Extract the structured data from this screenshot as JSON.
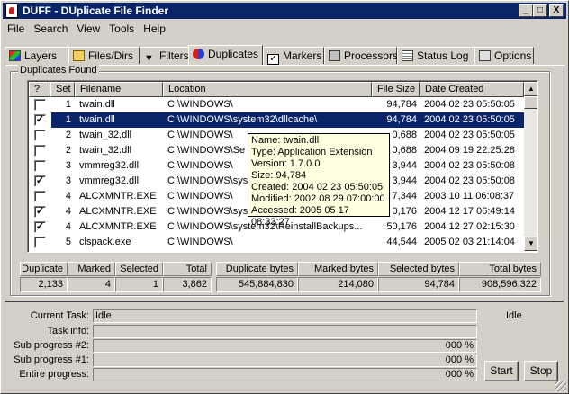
{
  "window": {
    "title": "DUFF - DUplicate File Finder"
  },
  "menu": [
    "File",
    "Search",
    "View",
    "Tools",
    "Help"
  ],
  "tabs": [
    {
      "label": "Layers",
      "icon": "layers-icon"
    },
    {
      "label": "Files/Dirs",
      "icon": "folder-icon"
    },
    {
      "label": "Filters",
      "icon": "filter-icon"
    },
    {
      "label": "Duplicates",
      "icon": "duplicates-icon",
      "active": true
    },
    {
      "label": "Markers",
      "icon": "checkbox-icon"
    },
    {
      "label": "Processors",
      "icon": "processor-icon"
    },
    {
      "label": "Status Log",
      "icon": "log-icon"
    },
    {
      "label": "Options",
      "icon": "options-icon"
    }
  ],
  "group_title": "Duplicates Found",
  "columns": [
    "?",
    "Set",
    "Filename",
    "Location",
    "File Size",
    "Date Created"
  ],
  "rows": [
    {
      "checked": false,
      "set": "1",
      "filename": "twain.dll",
      "location": "C:\\WINDOWS\\",
      "size": "94,784",
      "date": "2004 02 23 05:50:05",
      "selected": false
    },
    {
      "checked": true,
      "set": "1",
      "filename": "twain.dll",
      "location": "C:\\WINDOWS\\system32\\dllcache\\",
      "size": "94,784",
      "date": "2004 02 23 05:50:05",
      "selected": true
    },
    {
      "checked": false,
      "set": "2",
      "filename": "twain_32.dll",
      "location": "C:\\WINDOWS\\",
      "size": "0,688",
      "date": "2004 02 23 05:50:05",
      "selected": false
    },
    {
      "checked": false,
      "set": "2",
      "filename": "twain_32.dll",
      "location": "C:\\WINDOWS\\Se",
      "size": "0,688",
      "date": "2004 09 19 22:25:28",
      "selected": false
    },
    {
      "checked": false,
      "set": "3",
      "filename": "vmmreg32.dll",
      "location": "C:\\WINDOWS\\",
      "size": "3,944",
      "date": "2004 02 23 05:50:08",
      "selected": false
    },
    {
      "checked": true,
      "set": "3",
      "filename": "vmmreg32.dll",
      "location": "C:\\WINDOWS\\sys",
      "size": "3,944",
      "date": "2004 02 23 05:50:08",
      "selected": false
    },
    {
      "checked": false,
      "set": "4",
      "filename": "ALCXMNTR.EXE",
      "location": "C:\\WINDOWS\\",
      "size": "7,344",
      "date": "2003 10 11 06:08:37",
      "selected": false
    },
    {
      "checked": true,
      "set": "4",
      "filename": "ALCXMNTR.EXE",
      "location": "C:\\WINDOWS\\sys",
      "size": "0,176",
      "date": "2004 12 17 06:49:14",
      "selected": false
    },
    {
      "checked": true,
      "set": "4",
      "filename": "ALCXMNTR.EXE",
      "location": "C:\\WINDOWS\\system32\\ReinstallBackups...",
      "size": "50,176",
      "date": "2004 12 27 02:15:30",
      "selected": false
    },
    {
      "checked": false,
      "set": "5",
      "filename": "clspack.exe",
      "location": "C:\\WINDOWS\\",
      "size": "44,544",
      "date": "2005 02 03 21:14:04",
      "selected": false
    }
  ],
  "tooltip": [
    "Name: twain.dll",
    "Type: Application Extension",
    "Version: 1.7.0.0",
    "Size: 94,784",
    "Created: 2004 02 23 05:50:05",
    "Modified: 2002 08 29 07:00:00",
    "Accessed: 2005 05 17 08:33:27"
  ],
  "stats_left": {
    "headers": [
      "Duplicate",
      "Marked",
      "Selected",
      "Total"
    ],
    "values": [
      "2,133",
      "4",
      "1",
      "3,862"
    ]
  },
  "stats_right": {
    "headers": [
      "Duplicate bytes",
      "Marked bytes",
      "Selected bytes",
      "Total bytes"
    ],
    "values": [
      "545,884,830",
      "214,080",
      "94,784",
      "908,596,322"
    ]
  },
  "status": {
    "current_task_label": "Current Task:",
    "current_task_value": "Idle",
    "state": "Idle",
    "task_info_label": "Task info:",
    "task_info_value": "",
    "sub2_label": "Sub progress #2:",
    "sub2_value": "000 %",
    "sub1_label": "Sub progress #1:",
    "sub1_value": "000 %",
    "entire_label": "Entire progress:",
    "entire_value": "000 %"
  },
  "buttons": {
    "start": "Start",
    "stop": "Stop"
  },
  "title_buttons": {
    "minimize": "_",
    "maximize": "□",
    "close": "X"
  }
}
